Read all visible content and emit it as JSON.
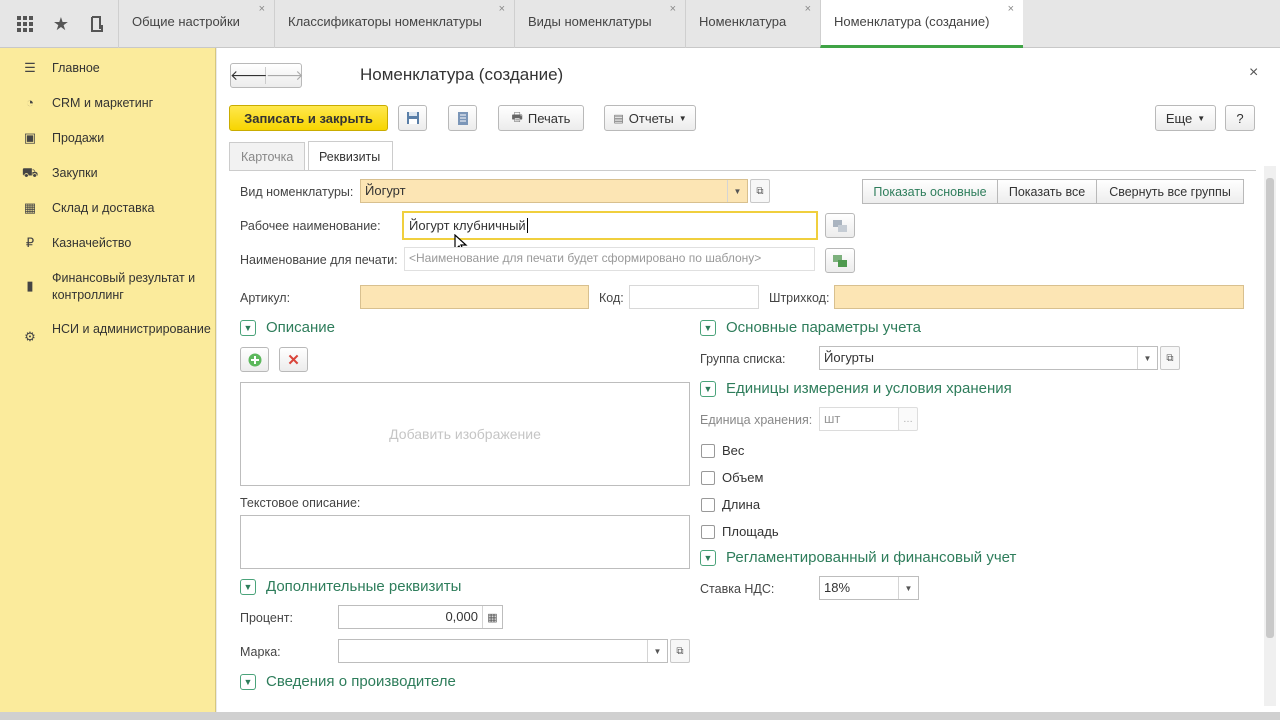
{
  "tabs": [
    "Общие настройки",
    "Классификаторы номенклатуры",
    "Виды номенклатуры",
    "Номенклатура",
    "Номенклатура (создание)"
  ],
  "sidebar": {
    "items": [
      {
        "label": "Главное",
        "icon": "list-icon"
      },
      {
        "label": "CRM и маркетинг",
        "icon": "chart-icon"
      },
      {
        "label": "Продажи",
        "icon": "briefcase-icon"
      },
      {
        "label": "Закупки",
        "icon": "cart-icon"
      },
      {
        "label": "Склад и доставка",
        "icon": "warehouse-icon"
      },
      {
        "label": "Казначейство",
        "icon": "ruble-icon"
      },
      {
        "label": "Финансовый результат и контроллинг",
        "icon": "bar-chart-icon"
      },
      {
        "label": "НСИ и администрирование",
        "icon": "gear-icon"
      }
    ]
  },
  "form": {
    "title": "Номенклатура (создание)",
    "save_close": "Записать и закрыть",
    "print": "Печать",
    "reports": "Отчеты",
    "more": "Еще",
    "help": "?",
    "tab_card": "Карточка",
    "tab_props": "Реквизиты",
    "show_main": "Показать основные",
    "show_all": "Показать все",
    "collapse_all": "Свернуть все группы",
    "kind_label": "Вид номенклатуры:",
    "kind_value": "Йогурт",
    "work_name_label": "Рабочее наименование:",
    "work_name_value": "Йогурт клубничный",
    "print_name_label": "Наименование для печати:",
    "print_name_placeholder": "<Наименование для печати будет сформировано по шаблону>",
    "article_label": "Артикул:",
    "code_label": "Код:",
    "barcode_label": "Штрихкод:",
    "description_section": "Описание",
    "add_image": "Добавить изображение",
    "text_description_label": "Текстовое описание:",
    "extra_section": "Дополнительные реквизиты",
    "percent_label": "Процент:",
    "percent_value": "0,000",
    "brand_label": "Марка:",
    "manufacturer_section": "Сведения о производителе",
    "accounting_section": "Основные параметры учета",
    "list_group_label": "Группа списка:",
    "list_group_value": "Йогурты",
    "units_section": "Единицы измерения и условия хранения",
    "storage_unit_label": "Единица хранения:",
    "storage_unit_value": "шт",
    "checkboxes": [
      "Вес",
      "Объем",
      "Длина",
      "Площадь"
    ],
    "regulated_section": "Регламентированный и финансовый учет",
    "vat_label": "Ставка НДС:",
    "vat_value": "18%"
  }
}
